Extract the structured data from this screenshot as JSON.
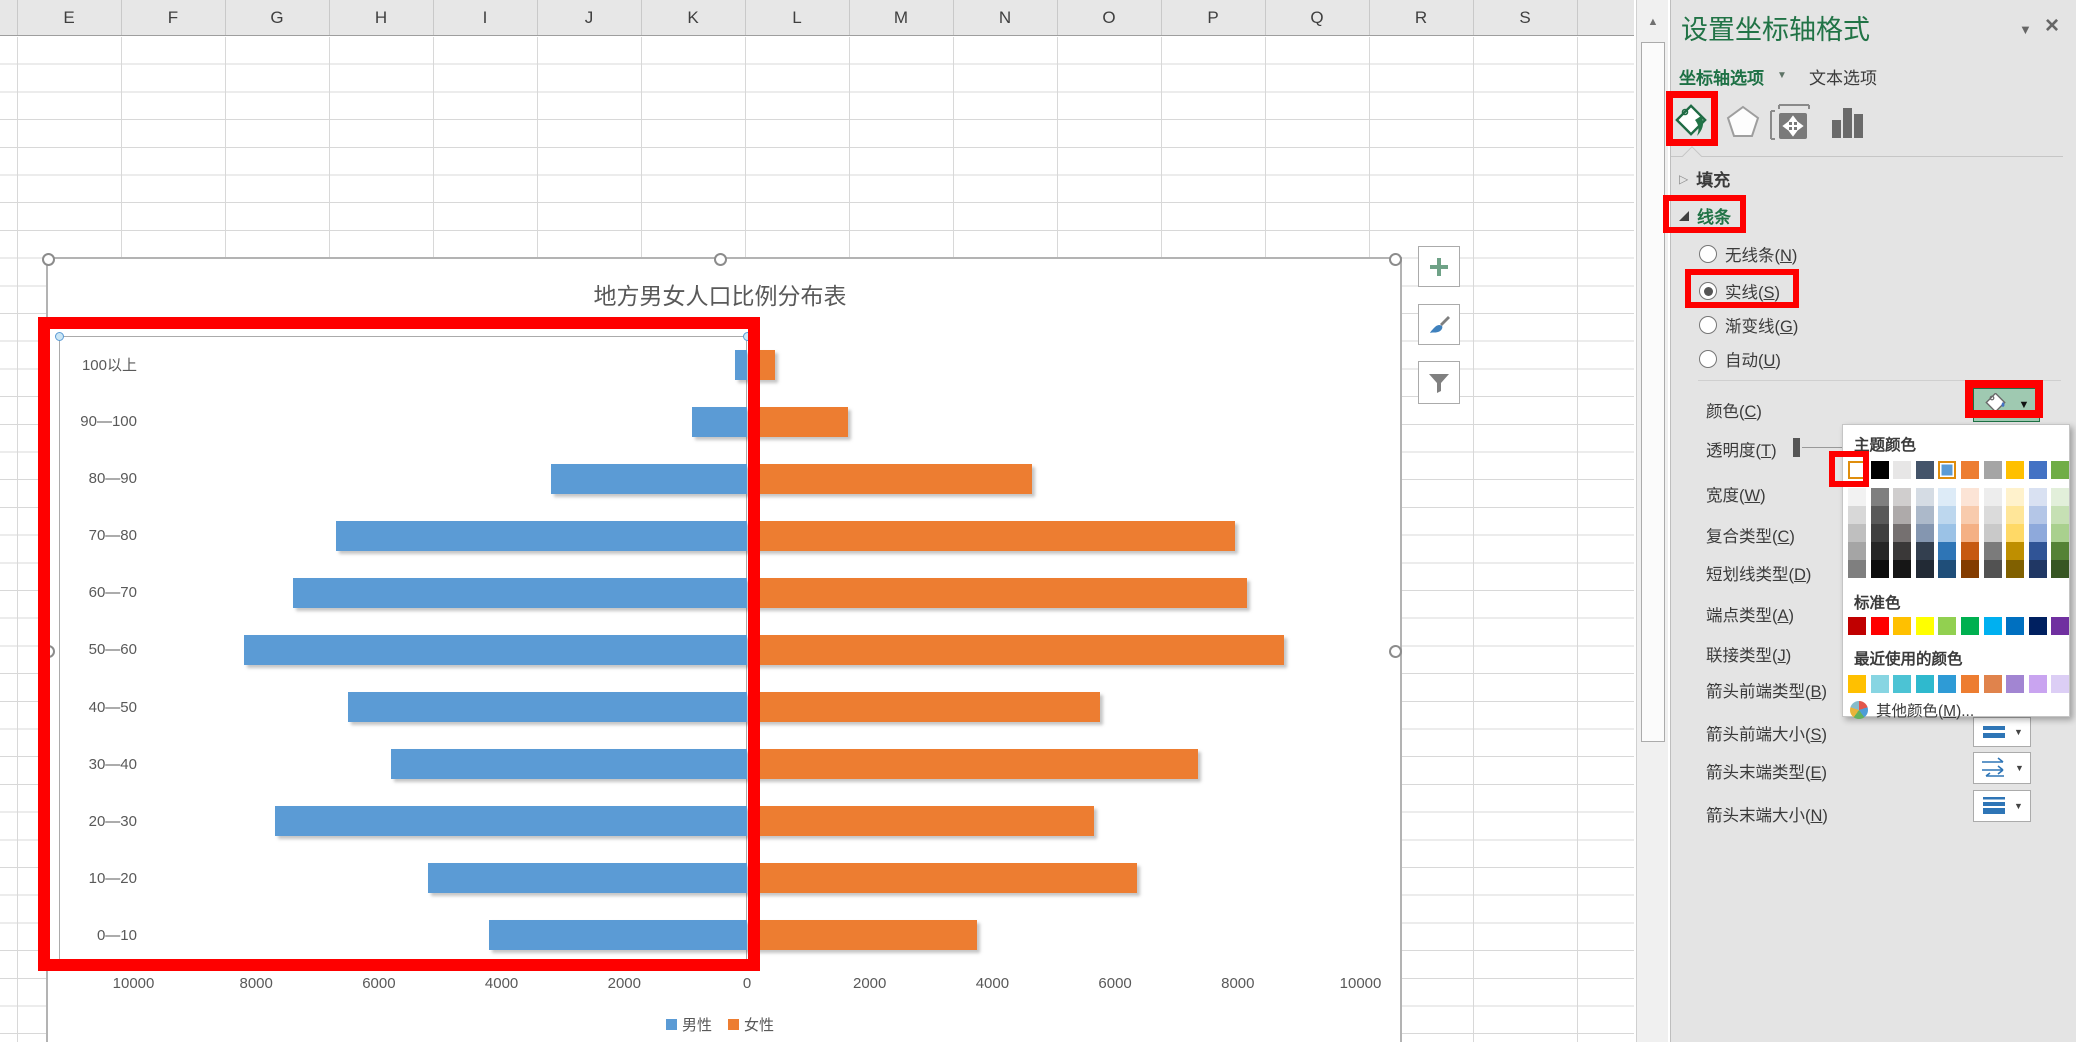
{
  "spreadsheet": {
    "columns": [
      "E",
      "F",
      "G",
      "H",
      "I",
      "J",
      "K",
      "L",
      "M",
      "N",
      "O",
      "P",
      "Q",
      "R",
      "S"
    ],
    "scrollbar_up_icon": "▲"
  },
  "chart": {
    "title": "地方男女人口比例分布表",
    "side_buttons": [
      {
        "icon": "plus-icon"
      },
      {
        "icon": "paintbrush-icon"
      },
      {
        "icon": "funnel-icon"
      }
    ]
  },
  "chart_data": {
    "type": "bar",
    "subtype": "population-pyramid-horizontal",
    "title": "地方男女人口比例分布表",
    "categories_top_to_bottom": [
      "100以上",
      "90—100",
      "80—90",
      "70—80",
      "60—70",
      "50—60",
      "40—50",
      "30—40",
      "20—30",
      "10—20",
      "0—10"
    ],
    "series": [
      {
        "name": "男性",
        "color": "#5B9BD5",
        "side": "left",
        "values_top_to_bottom": [
          200,
          900,
          3200,
          6700,
          7400,
          8200,
          6500,
          5800,
          7700,
          5200,
          4200
        ]
      },
      {
        "name": "女性",
        "color": "#ED7D31",
        "side": "right",
        "values_top_to_bottom": [
          400,
          1600,
          4600,
          7900,
          8100,
          8700,
          5700,
          7300,
          5600,
          6300,
          3700
        ]
      }
    ],
    "x_axis_ticks": [
      "10000",
      "8000",
      "6000",
      "4000",
      "2000",
      "0",
      "2000",
      "4000",
      "6000",
      "8000",
      "10000"
    ],
    "xlim": [
      -10000,
      10000
    ],
    "grid": false,
    "legend_position": "bottom"
  },
  "panel": {
    "title": "设置坐标轴格式",
    "tabs": [
      {
        "label": "坐标轴选项",
        "selected": true
      },
      {
        "label": "文本选项",
        "selected": false
      }
    ],
    "icon_tabs": [
      {
        "icon": "fill-line-icon",
        "selected": true
      },
      {
        "icon": "effects-icon",
        "selected": false
      },
      {
        "icon": "size-properties-icon",
        "selected": false
      },
      {
        "icon": "axis-options-icon",
        "selected": false
      }
    ],
    "sections": [
      {
        "label": "填充",
        "expanded": false
      },
      {
        "label": "线条",
        "expanded": true
      }
    ],
    "line_options": [
      {
        "label": "无线条(N)",
        "selected": false
      },
      {
        "label": "实线(S)",
        "selected": true
      },
      {
        "label": "渐变线(G)",
        "selected": false
      },
      {
        "label": "自动(U)",
        "selected": false
      }
    ],
    "properties": [
      {
        "label": "颜色(C)",
        "control": "color-button"
      },
      {
        "label": "透明度(T)",
        "control": "slider"
      },
      {
        "label": "宽度(W)"
      },
      {
        "label": "复合类型(C)"
      },
      {
        "label": "短划线类型(D)"
      },
      {
        "label": "端点类型(A)"
      },
      {
        "label": "联接类型(J)"
      },
      {
        "label": "箭头前端类型(B)"
      },
      {
        "label": "箭头前端大小(S)",
        "control": "dropdown"
      },
      {
        "label": "箭头末端类型(E)",
        "control": "dropdown"
      },
      {
        "label": "箭头末端大小(N)",
        "control": "dropdown"
      }
    ],
    "current_line_color": "#4472C4",
    "accent_green": "#217346"
  },
  "color_picker": {
    "theme_header": "主题颜色",
    "theme_colors": [
      "#FFFFFF",
      "#000000",
      "#E7E6E6",
      "#44546A",
      "#5B9BD5",
      "#ED7D31",
      "#A5A5A5",
      "#FFC000",
      "#4472C4",
      "#70AD47"
    ],
    "selected_theme_indices": [
      0,
      4
    ],
    "theme_variants": [
      [
        "#F2F2F2",
        "#D8D8D8",
        "#BFBFBF",
        "#A5A5A5",
        "#7F7F7F"
      ],
      [
        "#7F7F7F",
        "#595959",
        "#3F3F3F",
        "#262626",
        "#0C0C0C"
      ],
      [
        "#D0CECE",
        "#AEAAAA",
        "#757070",
        "#3A3838",
        "#161616"
      ],
      [
        "#D5DCE4",
        "#ACB9CA",
        "#8496B0",
        "#333F4F",
        "#222A35"
      ],
      [
        "#DDEBF7",
        "#BDD7EE",
        "#9BC2E6",
        "#2E75B6",
        "#1F4E79"
      ],
      [
        "#FCE4D6",
        "#F8CBAD",
        "#F4B084",
        "#C65911",
        "#833C00"
      ],
      [
        "#EDEDED",
        "#DBDBDB",
        "#C9C9C9",
        "#7B7B7B",
        "#525252"
      ],
      [
        "#FFF2CC",
        "#FFE699",
        "#FFD966",
        "#BF8F00",
        "#806000"
      ],
      [
        "#D9E1F2",
        "#B4C6E7",
        "#8EA9DB",
        "#305496",
        "#203764"
      ],
      [
        "#E2EFDA",
        "#C6E0B4",
        "#A9D08E",
        "#548235",
        "#375623"
      ]
    ],
    "standard_header": "标准色",
    "standard_colors": [
      "#C00000",
      "#FF0000",
      "#FFC000",
      "#FFFF00",
      "#92D050",
      "#00B050",
      "#00B0F0",
      "#0070C0",
      "#002060",
      "#7030A0"
    ],
    "recent_header": "最近使用的颜色",
    "recent_colors": [
      "#FFC000",
      "#87D5E2",
      "#4CC3D4",
      "#2FB9CE",
      "#2E9BD6",
      "#ED7D31",
      "#E0834C",
      "#A285D2",
      "#C9A4F0",
      "#DCCEF5"
    ],
    "more_colors_label": "其他颜色(M)..."
  },
  "annotations": {
    "color": "#FE0000"
  }
}
